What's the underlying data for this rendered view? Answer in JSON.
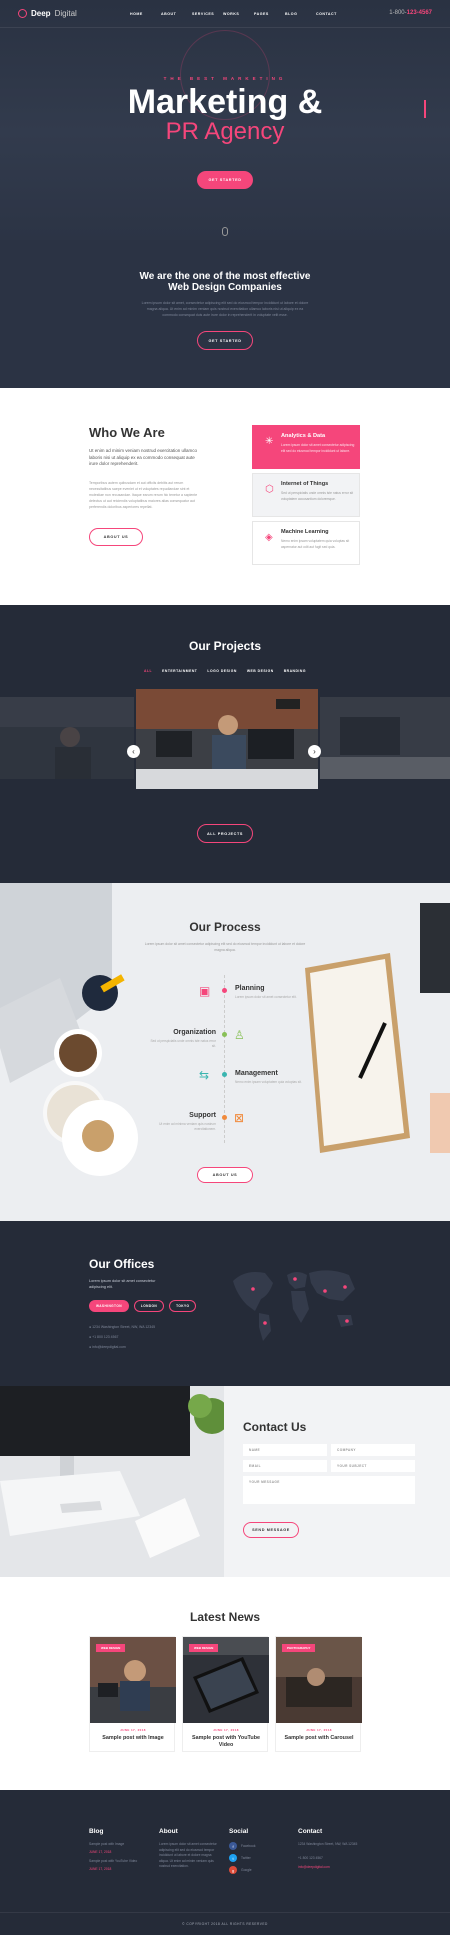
{
  "nav": {
    "brand_bold": "Deep",
    "brand_light": "Digital",
    "items": [
      "HOME",
      "ABOUT",
      "SERVICES",
      "WORKS",
      "PAGES",
      "BLOG",
      "CONTACT"
    ],
    "phone_prefix": "1-800-",
    "phone_number": "123-4567"
  },
  "hero": {
    "subtitle": "THE BEST MARKETING",
    "title_line1": "Marketing &",
    "title_line2": "PR Agency",
    "cta": "GET STARTED"
  },
  "effective": {
    "heading_line1": "We are the one of the most effective",
    "heading_line2": "Web Design Companies",
    "body": "Lorem ipsum dolor sit amet, consectetur adipiscing elit sed do eiusmod tempor incididunt ut labore et dolore magna aliqua. Ut enim ad minim veniam quis nostrud exercitation ullamco laboris nisi ut aliquip ex ea commodo consequat duis aute irure dolor in reprehenderit in voluptate velit esse.",
    "cta": "GET STARTED"
  },
  "who": {
    "heading": "Who We Are",
    "lead": "Ut enim ad minim veniam nostrud exercitation ullamco laboris nisi ut aliquip ex ea commodo consequat aute irure dolor reprehenderit.",
    "body": "Temporibus autem quibusdam et aut officiis debitis aut rerum necessitatibus saepe eveniet ut et voluptates repudiandae sint et molestiae non recusandae. Itaque earum rerum hic tenetur a sapiente delectus ut aut reiciendis voluptatibus maiores alias consequatur aut perferendis doloribus asperiores repellat.",
    "cta": "ABOUT US",
    "cards": [
      {
        "title": "Analytics & Data",
        "desc": "Lorem ipsum dolor sit amet consectetur adipiscing elit sed do eiusmod tempor incididunt ut labore."
      },
      {
        "title": "Internet of Things",
        "desc": "Sed ut perspiciatis unde omnis iste natus error sit voluptatem accusantium doloremque."
      },
      {
        "title": "Machine Learning",
        "desc": "Nemo enim ipsam voluptatem quia voluptas sit aspernatur aut odit aut fugit sed quia."
      }
    ]
  },
  "projects": {
    "heading": "Our Projects",
    "filters": [
      "ALL",
      "ENTERTAINMENT",
      "LOGO DESIGN",
      "WEB DESIGN",
      "BRANDING"
    ],
    "cta": "ALL PROJECTS"
  },
  "process": {
    "heading": "Our Process",
    "body": "Lorem ipsum dolor sit amet consectetur adipiscing elit sed do eiusmod tempor incididunt ut labore et dolore magna aliqua.",
    "steps": [
      {
        "title": "Planning",
        "desc": "Lorem ipsum dolor sit amet consectetur elit."
      },
      {
        "title": "Organization",
        "desc": "Sed ut perspiciatis unde omnis iste natus error sit."
      },
      {
        "title": "Management",
        "desc": "Nemo enim ipsam voluptatem quia voluptas sit."
      },
      {
        "title": "Support",
        "desc": "Ut enim ad minima veniam quis nostrum exercitationem."
      }
    ],
    "cta": "ABOUT US"
  },
  "offices": {
    "heading": "Our Offices",
    "body": "Lorem ipsum dolor sit amet consectetur adipiscing elit.",
    "tabs": [
      "WASHINGTON",
      "LONDON",
      "TOKYO"
    ],
    "address": "1234 Washington Street, NW, WA 12345",
    "phone": "+1 800 123 4567",
    "email": "info@deepdigital.com"
  },
  "contact": {
    "heading": "Contact Us",
    "fields": {
      "name": "NAME",
      "company": "COMPANY",
      "email": "EMAIL",
      "subject": "YOUR SUBJECT",
      "message": "YOUR MESSAGE"
    },
    "cta": "SEND MESSAGE"
  },
  "news": {
    "heading": "Latest News",
    "posts": [
      {
        "badge": "WEB DESIGN",
        "date": "JUNE 17, 2018",
        "title": "Sample post with Image"
      },
      {
        "badge": "WEB DESIGN",
        "date": "JUNE 17, 2018",
        "title": "Sample post with YouTube Video"
      },
      {
        "badge": "PHOTOGRAPHY",
        "date": "JUNE 17, 2018",
        "title": "Sample post with Carousel"
      }
    ]
  },
  "footer": {
    "blog": {
      "heading": "Blog",
      "l1": "Sample post with Image",
      "d1": "JUNE 17, 2018",
      "l2": "Sample post with YouTube Video",
      "d2": "JUNE 17, 2018"
    },
    "about": {
      "heading": "About",
      "body": "Lorem ipsum dolor sit amet consectetur adipiscing elit sed do eiusmod tempor incididunt ut labore et dolore magna aliqua. Ut enim ad minim veniam quis nostrud exercitation."
    },
    "social": {
      "heading": "Social",
      "items": [
        "Facebook",
        "Twitter",
        "Google"
      ]
    },
    "contact": {
      "heading": "Contact",
      "address": "1234 Washington Street, NW, WA 12345",
      "phone": "+1 800 123 4567",
      "email": "info@deepdigital.com"
    },
    "copyright": "© COPYRIGHT 2018 ALL RIGHTS RESERVED"
  },
  "colors": {
    "accent": "#f5467b",
    "dark": "#252b38",
    "hero": "#2b3344"
  }
}
